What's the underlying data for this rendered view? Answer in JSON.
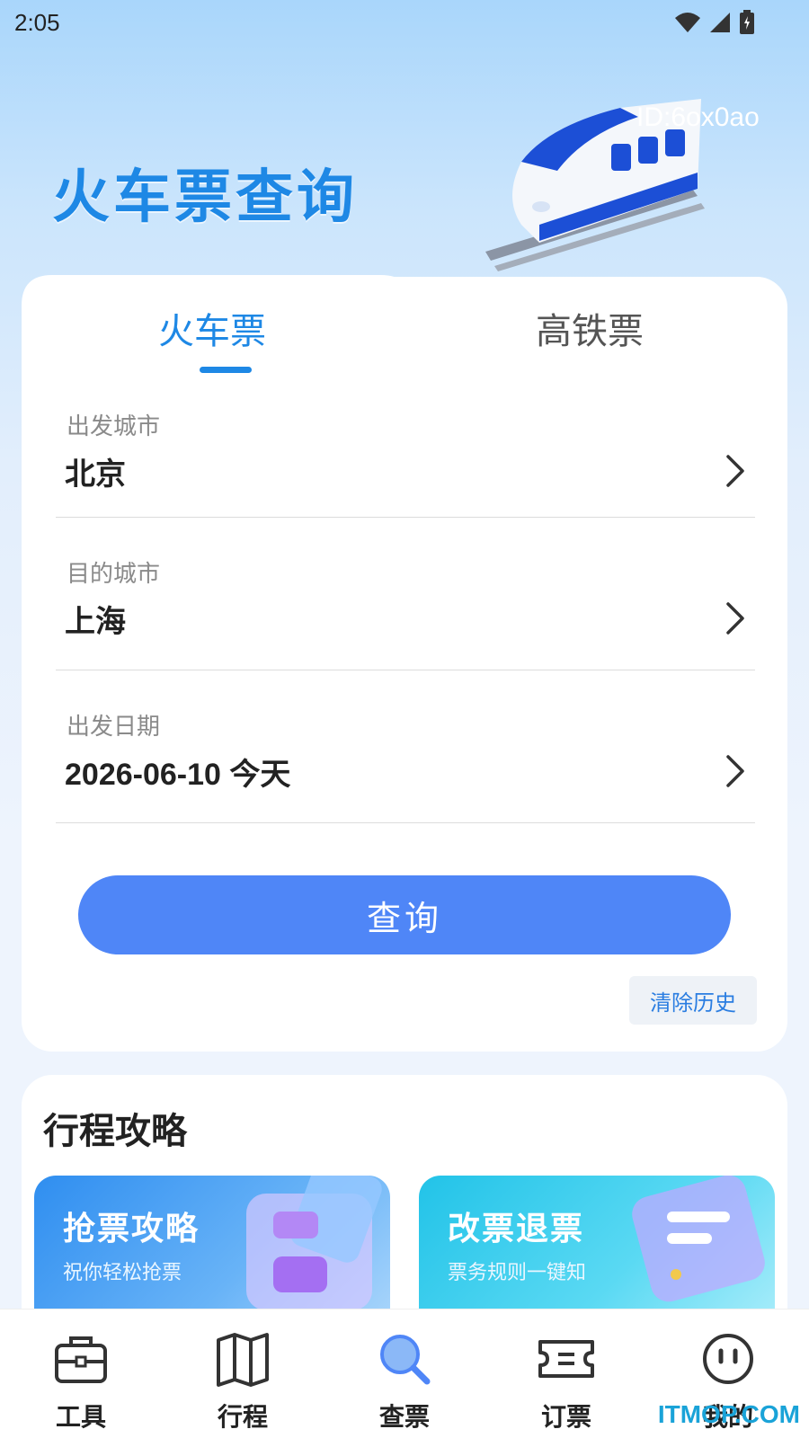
{
  "status_bar": {
    "time": "2:05"
  },
  "hero": {
    "title": "火车票查询",
    "id_label": "ID:6ox0ao"
  },
  "tabs": [
    {
      "label": "火车票",
      "active": true
    },
    {
      "label": "高铁票",
      "active": false
    }
  ],
  "form": {
    "departure": {
      "label": "出发城市",
      "value": "北京"
    },
    "destination": {
      "label": "目的城市",
      "value": "上海"
    },
    "date": {
      "label": "出发日期",
      "value": "2026-06-10 今天"
    }
  },
  "query_button": "查询",
  "clear_history_button": "清除历史",
  "guide": {
    "title": "行程攻略",
    "cards": [
      {
        "title": "抢票攻略",
        "subtitle": "祝你轻松抢票"
      },
      {
        "title": "改票退票",
        "subtitle": "票务规则一键知"
      }
    ]
  },
  "bottom_nav": [
    {
      "label": "工具",
      "icon": "toolbox-icon"
    },
    {
      "label": "行程",
      "icon": "map-icon"
    },
    {
      "label": "查票",
      "icon": "search-icon",
      "active": true
    },
    {
      "label": "订票",
      "icon": "ticket-icon"
    },
    {
      "label": "我的",
      "icon": "profile-icon"
    }
  ],
  "watermark": "ITMOP.COM",
  "colors": {
    "accent": "#1e88e5",
    "button": "#4f86f7",
    "link": "#2a7de1"
  }
}
